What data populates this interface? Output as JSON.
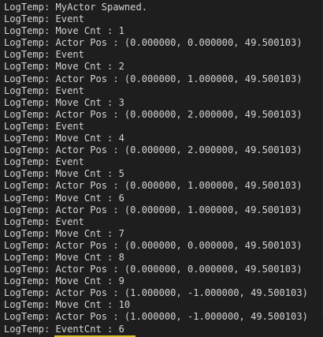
{
  "console": {
    "prefix": "LogTemp: ",
    "lines": [
      "MyActor Spawned.",
      "Event",
      "Move Cnt : 1",
      "Actor Pos : (0.000000, 0.000000, 49.500103)",
      "Event",
      "Move Cnt : 2",
      "Actor Pos : (0.000000, 1.000000, 49.500103)",
      "Event",
      "Move Cnt : 3",
      "Actor Pos : (0.000000, 2.000000, 49.500103)",
      "Event",
      "Move Cnt : 4",
      "Actor Pos : (0.000000, 2.000000, 49.500103)",
      "Event",
      "Move Cnt : 5",
      "Actor Pos : (0.000000, 1.000000, 49.500103)",
      "Move Cnt : 6",
      "Actor Pos : (0.000000, 1.000000, 49.500103)",
      "Event",
      "Move Cnt : 7",
      "Actor Pos : (0.000000, 0.000000, 49.500103)",
      "Move Cnt : 8",
      "Actor Pos : (0.000000, 0.000000, 49.500103)",
      "Move Cnt : 9",
      "Actor Pos : (1.000000, -1.000000, 49.500103)",
      "Move Cnt : 10",
      "Actor Pos : (1.000000, -1.000000, 49.500103)",
      "EventCnt : 6"
    ],
    "highlighted_line": "EventCnt : 6",
    "highlight_color": "#d4bf2a"
  }
}
